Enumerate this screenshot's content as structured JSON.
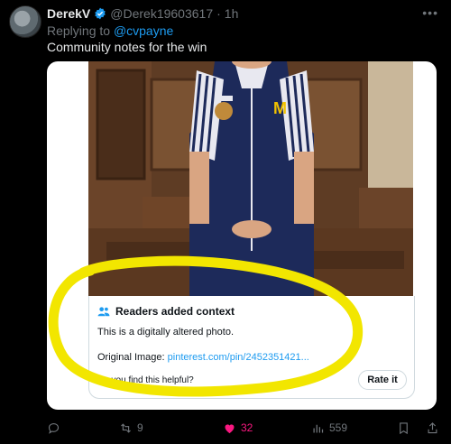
{
  "author": {
    "name": "DerekV",
    "handle": "@Derek19603617",
    "separator": "·",
    "time": "1h"
  },
  "reply": {
    "prefix": "Replying to ",
    "to": "@cvpayne"
  },
  "tweet": {
    "text": "Community notes for the win"
  },
  "note": {
    "header": "Readers added context",
    "body": "This is a digitally altered photo.",
    "original_label": "Original Image: ",
    "original_link": "pinterest.com/pin/2452351421...",
    "question": "Do you find this helpful?",
    "rate_label": "Rate it"
  },
  "actions": {
    "retweets": "9",
    "likes": "32",
    "views": "559"
  },
  "colors": {
    "accent": "#1d9bf0",
    "like": "#f91880",
    "highlight": "#f2e600",
    "muted": "#71767b"
  }
}
